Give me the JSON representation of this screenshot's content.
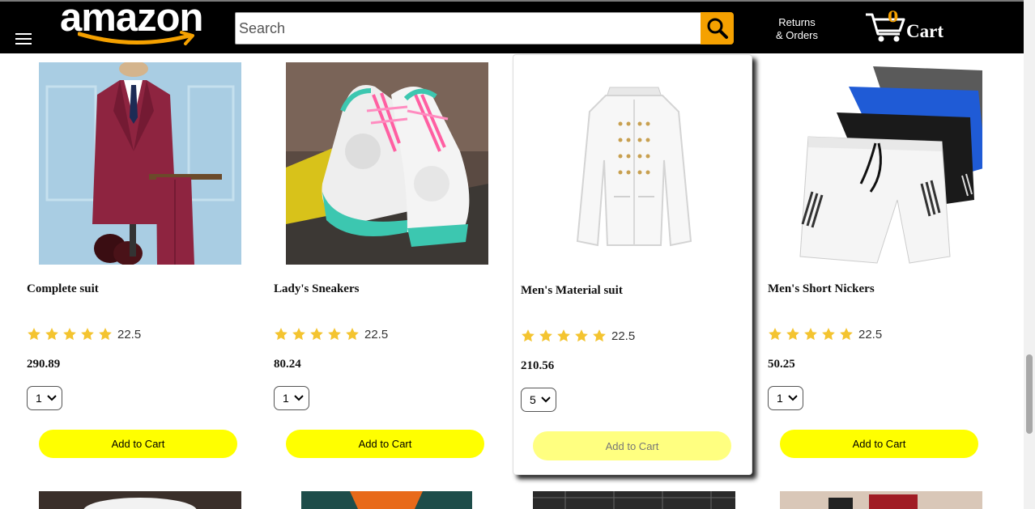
{
  "header": {
    "logo_text": "amazon",
    "search_placeholder": "Search",
    "returns_line1": "Returns",
    "returns_line2": "& Orders",
    "cart_count": "0",
    "cart_label": "Cart"
  },
  "products": [
    {
      "name": "Complete suit",
      "rating": "22.5",
      "stars": 5,
      "price": "290.89",
      "qty": "1",
      "add_label": "Add to Cart",
      "image": "maroon-suit"
    },
    {
      "name": "Lady's Sneakers",
      "rating": "22.5",
      "stars": 5,
      "price": "80.24",
      "qty": "1",
      "add_label": "Add to Cart",
      "image": "sneakers"
    },
    {
      "name": "Men's Material suit",
      "rating": "22.5",
      "stars": 5,
      "price": "210.56",
      "qty": "5",
      "add_label": "Add to Cart",
      "image": "white-jacket"
    },
    {
      "name": "Men's Short Nickers",
      "rating": "22.5",
      "stars": 5,
      "price": "50.25",
      "qty": "1",
      "add_label": "Add to Cart",
      "image": "shorts"
    }
  ],
  "colors": {
    "header_bg": "#000000",
    "accent_orange": "#f5a100",
    "button_yellow": "#ffff00",
    "star_color": "#f4c430"
  }
}
